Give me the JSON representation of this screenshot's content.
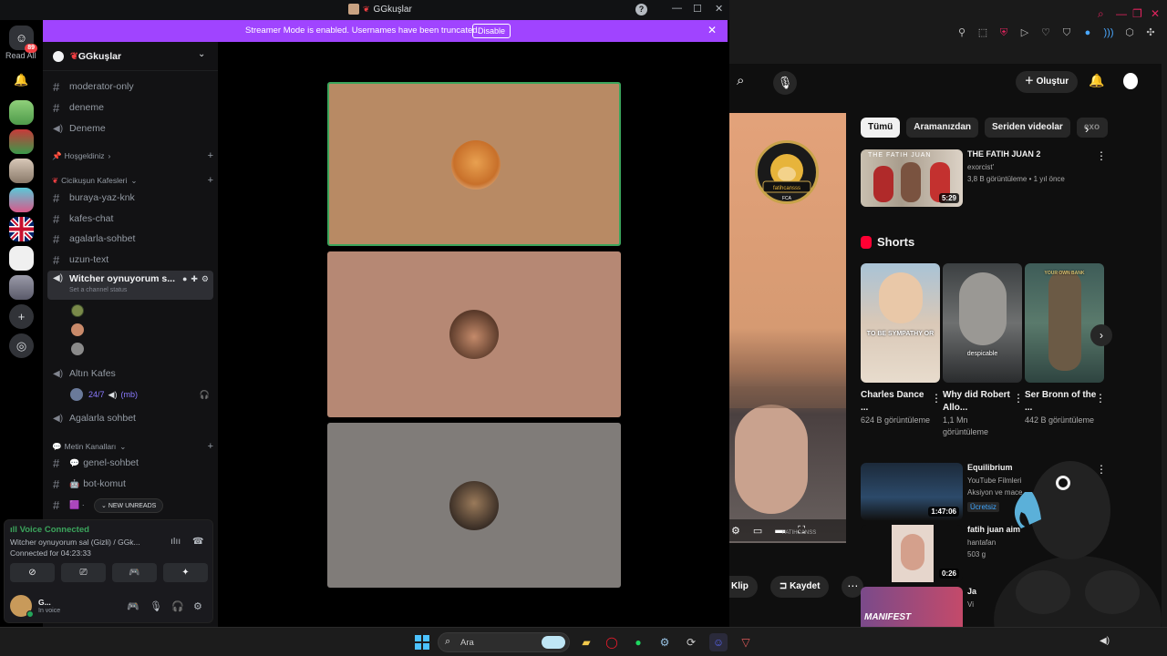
{
  "discord": {
    "window_title": "GGkuşlar",
    "streamer_bar": {
      "message": "Streamer Mode is enabled. Usernames have been truncated.",
      "disable_label": "Disable"
    },
    "guild_rail": {
      "dm_badge": "89",
      "read_all": "Read All"
    },
    "server_name": "GGkuşlar",
    "channels": {
      "moderator_only": "moderator-only",
      "deneme_text": "deneme",
      "deneme_voice": "Deneme",
      "cat_hosgeldiniz": "Hoşgeldiniz",
      "cat_cicikusun": "Cicikuşun Kafesleri",
      "buraya": "buraya-yaz-knk",
      "kafes": "kafes-chat",
      "agalarla": "agalarla-sohbet",
      "uzun": "uzun-text",
      "witcher": "Witcher oynuyorum s...",
      "witcher_status": "Set a channel status",
      "altin_kafes": "Altın Kafes",
      "altin_sub": "24/7",
      "altin_sub2": "(mb)",
      "agalarla_voice": "Agalarla sohbet",
      "cat_metin": "Metin Kanalları",
      "genel": "genel-sohbet",
      "bot": "bot-komut"
    },
    "new_unreads": "NEW UNREADS",
    "voice_panel": {
      "title": "Voice Connected",
      "channel": "Witcher oynuyorum sal (Gizli) / GGk...",
      "connected_for_label": "Connected for",
      "connected_for": "04:23:33",
      "user_name": "G...",
      "user_status": "In voice"
    }
  },
  "youtube": {
    "create_label": "Oluştur",
    "chips": [
      "Tümü",
      "Aramanızdan",
      "Seriden videolar",
      "exo"
    ],
    "top_video": {
      "title": "THE FATIH JUAN 2",
      "channel": "exorcist'",
      "meta": "3,8 B görüntüleme • 1 yıl önce",
      "duration": "5:29",
      "thumb_text": "THE FATIH JUAN"
    },
    "shorts_title": "Shorts",
    "shorts": [
      {
        "title": "Charles Dance ...",
        "views": "624 B görüntüleme",
        "caption": "TO BE SYMPATHY OR"
      },
      {
        "title": "Why did Robert Allo...",
        "views": "1,1 Mn görüntüleme",
        "caption": "despicable"
      },
      {
        "title": "Ser Bronn of the ...",
        "views": "442 B görüntüleme",
        "caption": "YOUR OWN BANK"
      }
    ],
    "videos": [
      {
        "title": "Equilibrium",
        "channel": "YouTube Filmleri",
        "meta": "Aksiyon ve mace",
        "badge": "Ücretsiz",
        "duration": "1:47:06"
      },
      {
        "title": "fatih juan aim",
        "channel": "hantafan",
        "meta": "503 g",
        "duration": "0:26"
      },
      {
        "title": "Ja",
        "channel": "Vi",
        "meta": "",
        "duration": "",
        "thumb_text": "MANIFEST"
      }
    ],
    "actions": {
      "clip": "Klip",
      "save": "Kaydet"
    },
    "player_logo": "fatihcansss",
    "player_logo_sub": "FCA",
    "player_watermark": "FATIHCANSS"
  },
  "taskbar": {
    "search_label": "Ara"
  },
  "colors": {
    "discord_accent": "#a044ff",
    "voice_green": "#3ba55c",
    "youtube_red": "#ff0033"
  }
}
